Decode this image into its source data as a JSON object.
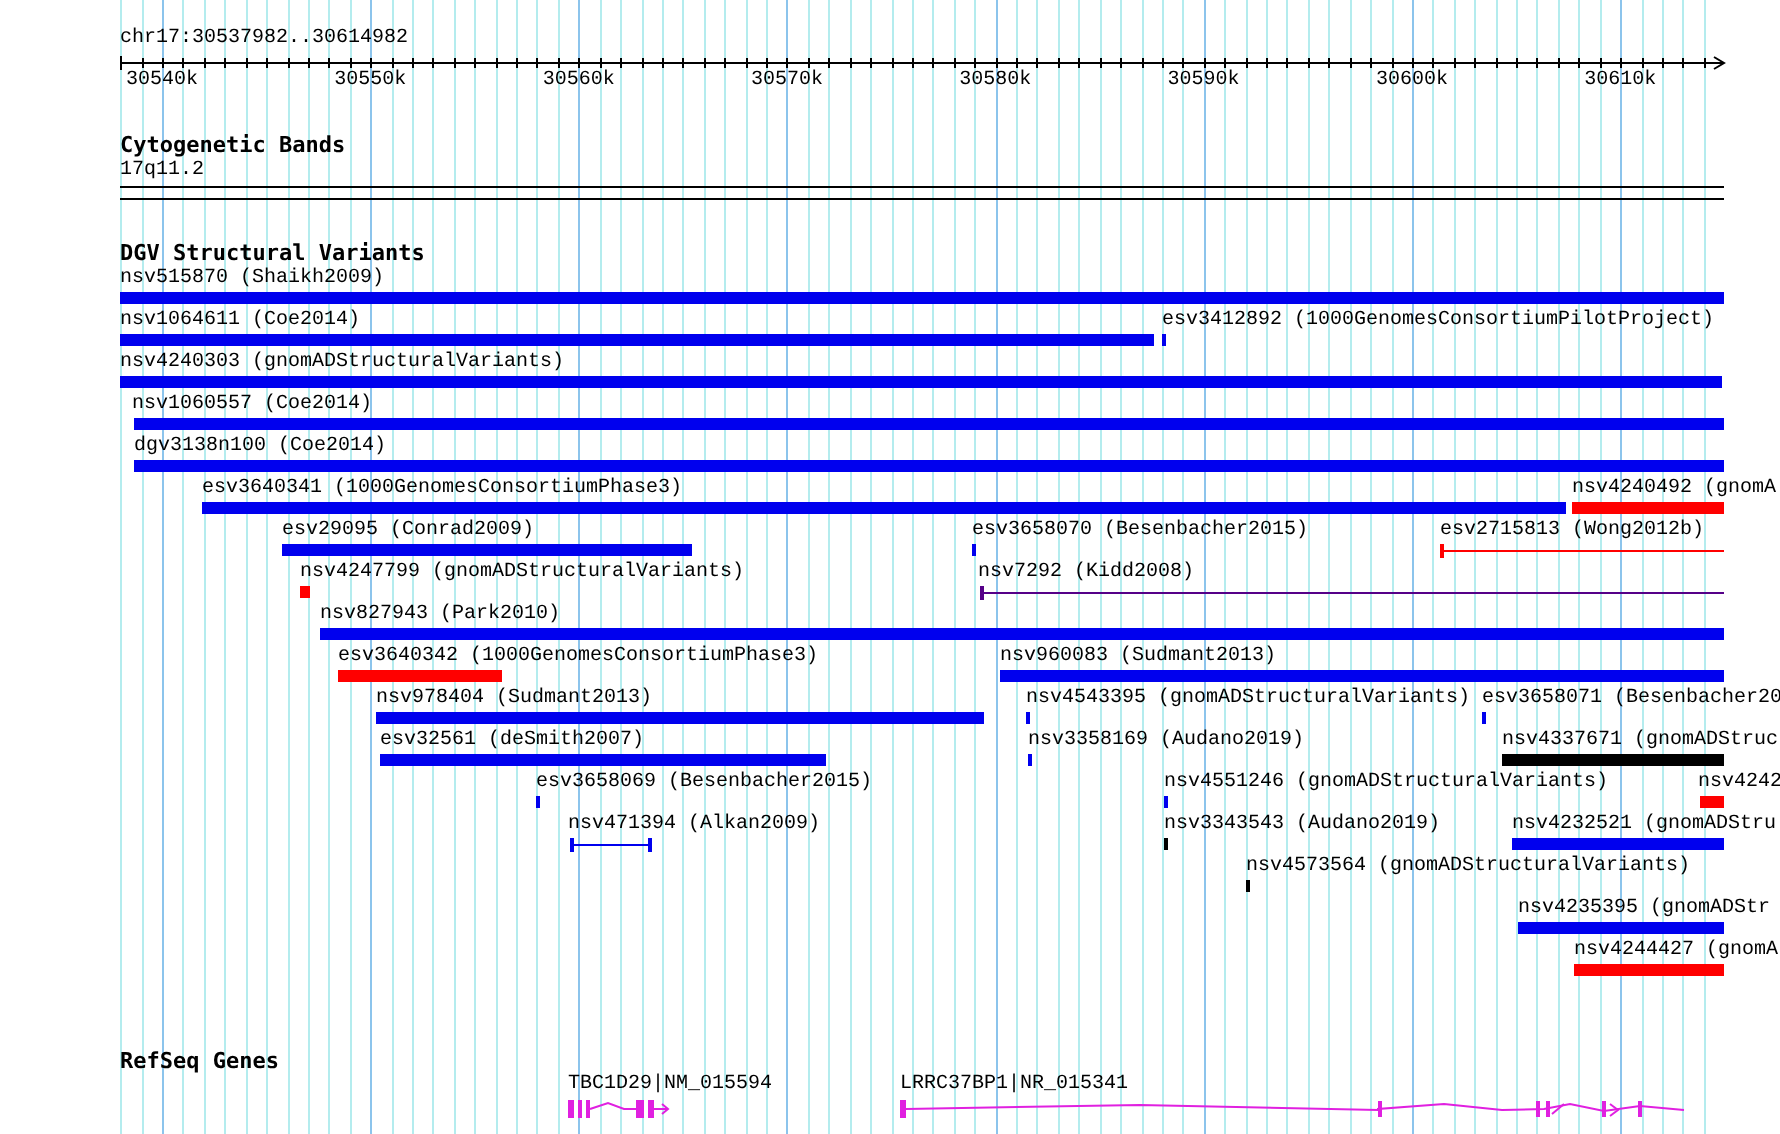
{
  "location": "chr17:30537982..30614982",
  "ruler": {
    "ticks": [
      "30540k",
      "30550k",
      "30560k",
      "30570k",
      "30580k",
      "30590k",
      "30600k",
      "30610k"
    ]
  },
  "tracks": [
    {
      "title": "Cytogenetic Bands",
      "kind": "bands",
      "features": [
        {
          "label": "17q11.2"
        }
      ]
    },
    {
      "title": "DGV Structural Variants",
      "kind": "variants",
      "rows": [
        [
          {
            "label": "nsv515870 (Shaikh2009)",
            "color": "#0000ee",
            "kind": "bar"
          }
        ],
        [
          {
            "label": "nsv1064611 (Coe2014)",
            "color": "#0000ee",
            "kind": "bar"
          },
          {
            "label": "esv3412892 (1000GenomesConsortiumPilotProject)",
            "color": "#0000ee",
            "kind": "bar"
          }
        ],
        [
          {
            "label": "nsv4240303 (gnomADStructuralVariants)",
            "color": "#0000ee",
            "kind": "bar"
          }
        ],
        [
          {
            "label": "nsv1060557 (Coe2014)",
            "color": "#0000ee",
            "kind": "bar"
          }
        ],
        [
          {
            "label": "dgv3138n100 (Coe2014)",
            "color": "#0000ee",
            "kind": "bar"
          }
        ],
        [
          {
            "label": "esv3640341 (1000GenomesConsortiumPhase3)",
            "color": "#0000ee",
            "kind": "bar"
          },
          {
            "label": "nsv4240492 (gnomA",
            "color": "#ff0000",
            "kind": "bar"
          }
        ],
        [
          {
            "label": "esv29095 (Conrad2009)",
            "color": "#0000ee",
            "kind": "bar"
          },
          {
            "label": "esv3658070 (Besenbacher2015)",
            "color": "#0000ee",
            "kind": "bar"
          },
          {
            "label": "esv2715813 (Wong2012b)",
            "color": "#ff0000",
            "kind": "span"
          }
        ],
        [
          {
            "label": "nsv4247799 (gnomADStructuralVariants)",
            "color": "#ff0000",
            "kind": "bar"
          },
          {
            "label": "nsv7292 (Kidd2008)",
            "color": "#550088",
            "kind": "span"
          }
        ],
        [
          {
            "label": "nsv827943 (Park2010)",
            "color": "#0000ee",
            "kind": "bar"
          }
        ],
        [
          {
            "label": "esv3640342 (1000GenomesConsortiumPhase3)",
            "color": "#ff0000",
            "kind": "bar"
          },
          {
            "label": "nsv960083 (Sudmant2013)",
            "color": "#0000ee",
            "kind": "bar"
          }
        ],
        [
          {
            "label": "nsv978404 (Sudmant2013)",
            "color": "#0000ee",
            "kind": "bar"
          },
          {
            "label": "nsv4543395 (gnomADStructuralVariants)",
            "color": "#0000ee",
            "kind": "bar"
          },
          {
            "label": "esv3658071 (Besenbacher20",
            "color": "#0000ee",
            "kind": "bar"
          }
        ],
        [
          {
            "label": "esv32561 (deSmith2007)",
            "color": "#0000ee",
            "kind": "bar"
          },
          {
            "label": "nsv3358169 (Audano2019)",
            "color": "#0000ee",
            "kind": "bar"
          },
          {
            "label": "nsv4337671 (gnomADStruc",
            "color": "#000000",
            "kind": "bar"
          }
        ],
        [
          {
            "label": "esv3658069 (Besenbacher2015)",
            "color": "#0000ee",
            "kind": "bar"
          },
          {
            "label": "nsv4551246 (gnomADStructuralVariants)",
            "color": "#0000ee",
            "kind": "bar"
          },
          {
            "label": "nsv4242",
            "color": "#ff0000",
            "kind": "bar"
          }
        ],
        [
          {
            "label": "nsv471394 (Alkan2009)",
            "color": "#0000ee",
            "kind": "interval"
          },
          {
            "label": "nsv3343543 (Audano2019)",
            "color": "#000000",
            "kind": "bar"
          },
          {
            "label": "nsv4232521 (gnomADStru",
            "color": "#0000ee",
            "kind": "bar"
          }
        ],
        [
          {
            "label": "nsv4573564 (gnomADStructuralVariants)",
            "color": "#000000",
            "kind": "bar"
          }
        ],
        [
          {
            "label": "nsv4235395 (gnomADStr",
            "color": "#0000ee",
            "kind": "bar"
          }
        ],
        [
          {
            "label": "nsv4244427 (gnomA",
            "color": "#ff0000",
            "kind": "bar"
          }
        ]
      ]
    },
    {
      "title": "RefSeq Genes",
      "kind": "genes",
      "features": [
        {
          "label": "TBC1D29|NM_015594"
        },
        {
          "label": "LRRC37BP1|NR_015341"
        }
      ]
    }
  ]
}
